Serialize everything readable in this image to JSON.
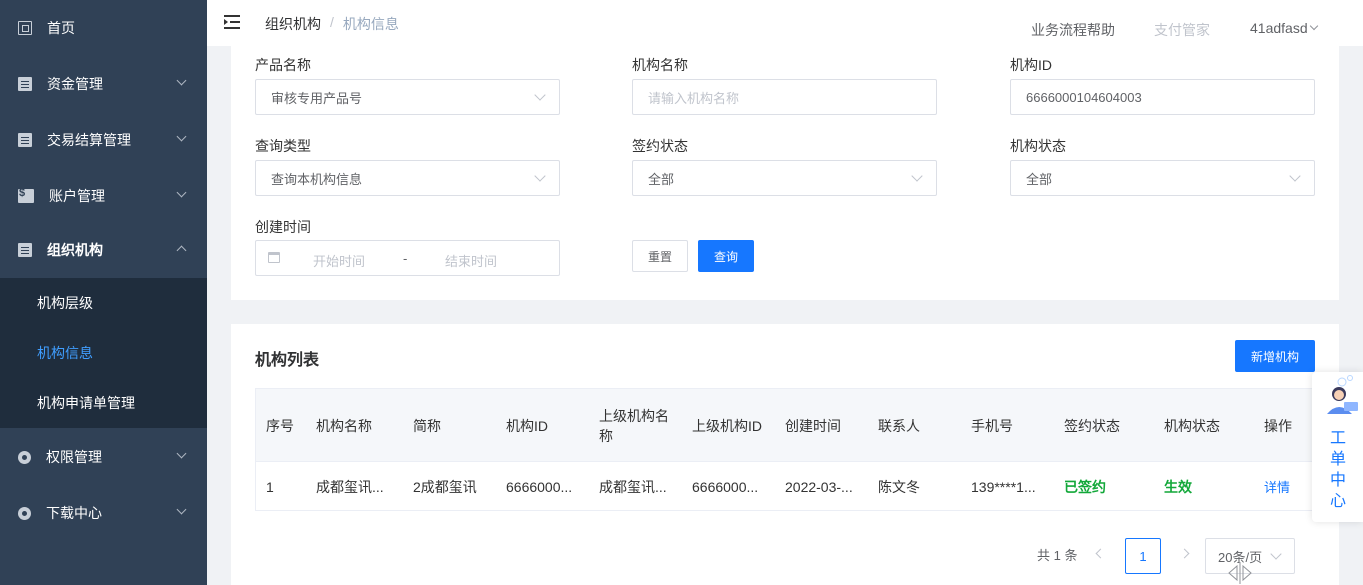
{
  "sidebar": {
    "items": [
      {
        "label": "首页",
        "icon": "home-icon"
      },
      {
        "label": "资金管理",
        "icon": "fund-icon"
      },
      {
        "label": "交易结算管理",
        "icon": "document-icon"
      },
      {
        "label": "账户管理",
        "icon": "account-icon"
      },
      {
        "label": "组织机构",
        "icon": "document-icon"
      },
      {
        "label": "权限管理",
        "icon": "gear-icon"
      },
      {
        "label": "下载中心",
        "icon": "gear-icon"
      }
    ],
    "submenu": [
      {
        "label": "机构层级"
      },
      {
        "label": "机构信息"
      },
      {
        "label": "机构申请单管理"
      }
    ],
    "active_color": "#409eff",
    "bg_color": "#304156"
  },
  "header": {
    "breadcrumb": {
      "parent": "组织机构",
      "separator": "/",
      "current": "机构信息"
    },
    "help_link": "业务流程帮助",
    "pay_link": "支付管家",
    "user": "41adfasd"
  },
  "search": {
    "product_name": {
      "label": "产品名称",
      "value": "审核专用产品号"
    },
    "org_name": {
      "label": "机构名称",
      "placeholder": "请输入机构名称"
    },
    "org_id": {
      "label": "机构ID",
      "value": "6666000104604003"
    },
    "query_type": {
      "label": "查询类型",
      "value": "查询本机构信息"
    },
    "sign_status": {
      "label": "签约状态",
      "value": "全部"
    },
    "org_status": {
      "label": "机构状态",
      "value": "全部"
    },
    "created_time": {
      "label": "创建时间",
      "start_placeholder": "开始时间",
      "separator": "-",
      "end_placeholder": "结束时间"
    },
    "reset_label": "重置",
    "query_label": "查询"
  },
  "list": {
    "title": "机构列表",
    "add_label": "新增机构",
    "columns": [
      "序号",
      "机构名称",
      "简称",
      "机构ID",
      "上级机构名称",
      "上级机构ID",
      "创建时间",
      "联系人",
      "手机号",
      "签约状态",
      "机构状态",
      "操作"
    ],
    "rows": [
      {
        "index": "1",
        "name": "成都玺讯...",
        "short_name": "2成都玺讯",
        "org_id": "6666000...",
        "parent_name": "成都玺讯...",
        "parent_id": "6666000...",
        "created": "2022-03-...",
        "contact": "陈文冬",
        "phone": "139****1...",
        "sign_status": "已签约",
        "org_status": "生效",
        "action": "详情"
      }
    ],
    "status_color": "#13a83a",
    "link_color": "#1677ff"
  },
  "pagination": {
    "total": "共 1 条",
    "current_page": "1",
    "page_size": "20条/页"
  },
  "float_widget": {
    "label": "工单中心"
  }
}
